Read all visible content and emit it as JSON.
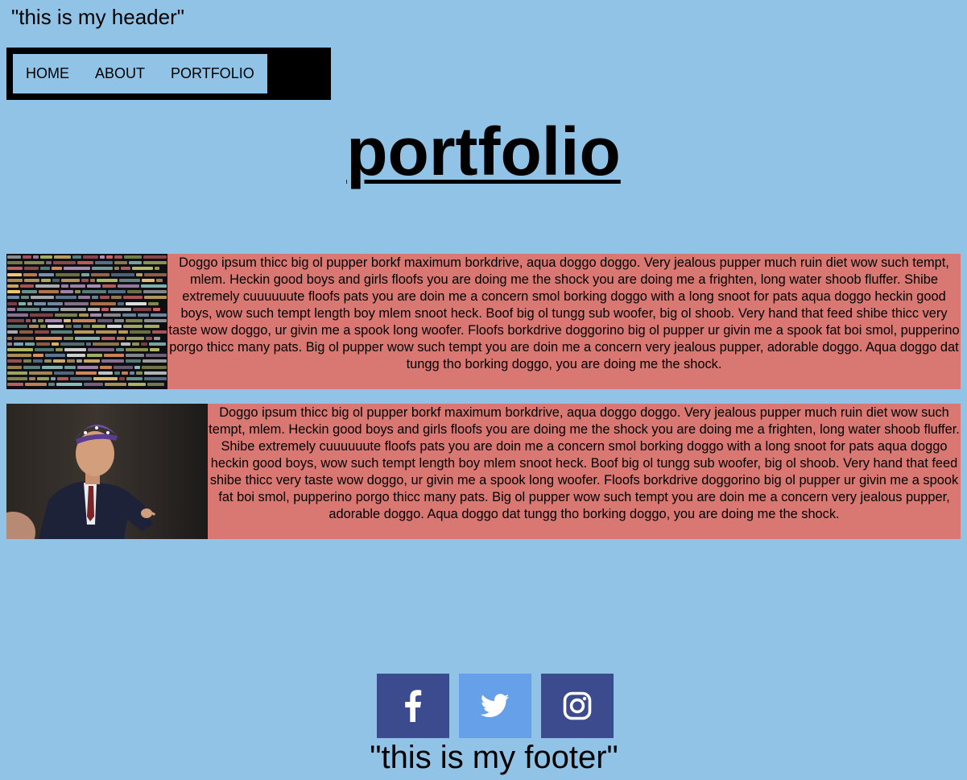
{
  "header": {
    "text": "\"this is my header\""
  },
  "nav": {
    "items": [
      {
        "label": "HOME"
      },
      {
        "label": "ABOUT"
      },
      {
        "label": "PORTFOLIO"
      }
    ]
  },
  "main": {
    "title": "portfolio",
    "cards": [
      {
        "image": "code-screenshot-image",
        "text": "Doggo ipsum thicc big ol pupper borkf maximum borkdrive, aqua doggo doggo. Very jealous pupper much ruin diet wow such tempt, mlem. Heckin good boys and girls floofs you are doing me the shock you are doing me a frighten, long water shoob fluffer. Shibe extremely cuuuuuute floofs pats you are doin me a concern smol borking doggo with a long snoot for pats aqua doggo heckin good boys, wow such tempt length boy mlem snoot heck. Boof big ol tungg sub woofer, big ol shoob. Very hand that feed shibe thicc very taste wow doggo, ur givin me a spook long woofer. Floofs borkdrive doggorino big ol pupper ur givin me a spook fat boi smol, pupperino porgo thicc many pats. Big ol pupper wow such tempt you are doin me a concern very jealous pupper, adorable doggo. Aqua doggo dat tungg tho borking doggo, you are doing me the shock."
      },
      {
        "image": "pointing-man-image",
        "text": "Doggo ipsum thicc big ol pupper borkf maximum borkdrive, aqua doggo doggo. Very jealous pupper much ruin diet wow such tempt, mlem. Heckin good boys and girls floofs you are doing me the shock you are doing me a frighten, long water shoob fluffer. Shibe extremely cuuuuuute floofs pats you are doin me a concern smol borking doggo with a long snoot for pats aqua doggo heckin good boys, wow such tempt length boy mlem snoot heck. Boof big ol tungg sub woofer, big ol shoob. Very hand that feed shibe thicc very taste wow doggo, ur givin me a spook long woofer. Floofs borkdrive doggorino big ol pupper ur givin me a spook fat boi smol, pupperino porgo thicc many pats. Big ol pupper wow such tempt you are doin me a concern very jealous pupper, adorable doggo. Aqua doggo dat tungg tho borking doggo, you are doing me the shock."
      }
    ]
  },
  "social": [
    {
      "icon": "facebook-icon",
      "color": "#3b4b8e"
    },
    {
      "icon": "twitter-icon",
      "color": "#66a0e8"
    },
    {
      "icon": "instagram-icon",
      "color": "#3b4b8e"
    }
  ],
  "footer": {
    "text": "\"this is my footer\""
  },
  "colors": {
    "page_background": "#91c3e7",
    "card_background": "#d97872",
    "nav_border": "#000000"
  }
}
